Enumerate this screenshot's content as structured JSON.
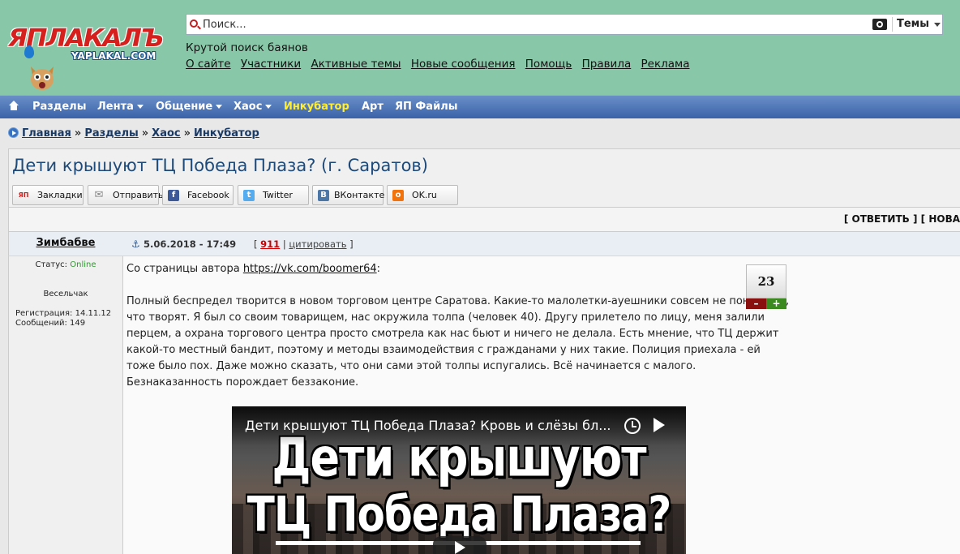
{
  "header": {
    "logo_text": "ЯПЛАКАЛЪ",
    "logo_sub": "YAPLAKAL.COM",
    "search_placeholder": "Поиск...",
    "topics_label": "Темы",
    "tagline": "Крутой поиск баянов",
    "links": [
      "О сайте",
      "Участники",
      "Активные темы",
      "Новые сообщения",
      "Помощь",
      "Правила",
      "Реклама"
    ]
  },
  "nav": {
    "items": [
      {
        "label": "Разделы",
        "caret": false
      },
      {
        "label": "Лента",
        "caret": true
      },
      {
        "label": "Общение",
        "caret": true
      },
      {
        "label": "Хаос",
        "caret": true
      },
      {
        "label": "Инкубатор",
        "caret": false,
        "highlight": true
      },
      {
        "label": "Арт",
        "caret": false
      },
      {
        "label": "ЯП Файлы",
        "caret": false
      }
    ]
  },
  "breadcrumb": [
    "Главная",
    "Разделы",
    "Хаос",
    "Инкубатор"
  ],
  "breadcrumb_sep": "»",
  "topic": {
    "title": "Дети крышуют ТЦ Победа Плаза? (г. Саратов)"
  },
  "share": [
    {
      "label": "Закладки",
      "icon": "yp-bookmark-icon",
      "color": "#ffffff",
      "glyph": "ЯП"
    },
    {
      "label": "Отправить",
      "icon": "envelope-icon",
      "color": "#888888",
      "glyph": "✉"
    },
    {
      "label": "Facebook",
      "icon": "facebook-icon",
      "color": "#3b5998",
      "glyph": "f"
    },
    {
      "label": "Twitter",
      "icon": "twitter-icon",
      "color": "#55acee",
      "glyph": "t"
    },
    {
      "label": "ВКонтакте",
      "icon": "vk-icon",
      "color": "#4a76a8",
      "glyph": "B"
    },
    {
      "label": "OK.ru",
      "icon": "odnoklassniki-icon",
      "color": "#f2720c",
      "glyph": "o"
    }
  ],
  "actions": {
    "reply": "[ ОТВЕТИТЬ ]",
    "new": "[ НОВА"
  },
  "post": {
    "author": "Зимбабве",
    "date": "5.06.2018 - 17:49",
    "number": "911",
    "quote_label": "цитировать",
    "status_label": "Статус:",
    "status_value": "Online",
    "rank": "Весельчак",
    "registered": "Регистрация: 14.11.12",
    "messages": "Сообщений: 149",
    "rating": "23",
    "rating_minus": "–",
    "rating_plus": "+",
    "intro": "Со страницы автора ",
    "author_link": "https://vk.com/boomer64",
    "intro_end": ":",
    "body": "Полный беспредел творится в новом торговом центре Саратова. Какие-то малолетки-ауешники совсем не понимают, что творят. Я был со своим товарищем, нас окружила толпа (человек 40). Другу прилетело по лицу, меня залили перцем, а охрана торгового центра просто смотрела как нас бьют и ничего не делала. Есть мнение, что ТЦ держит какой-то местный бандит, поэтому и методы взаимодействия с гражданами у них такие. Полиция приехала - ей тоже было пох. Даже можно сказать, что они сами этой толпы испугались. Всё начинается с малого. Безнаказанность порождает беззаконие."
  },
  "video": {
    "title": "Дети крышуют ТЦ Победа Плаза? Кровь и слёзы бл...",
    "line1": "Дети крышуют",
    "line2": "ТЦ Победа Плаза?"
  }
}
